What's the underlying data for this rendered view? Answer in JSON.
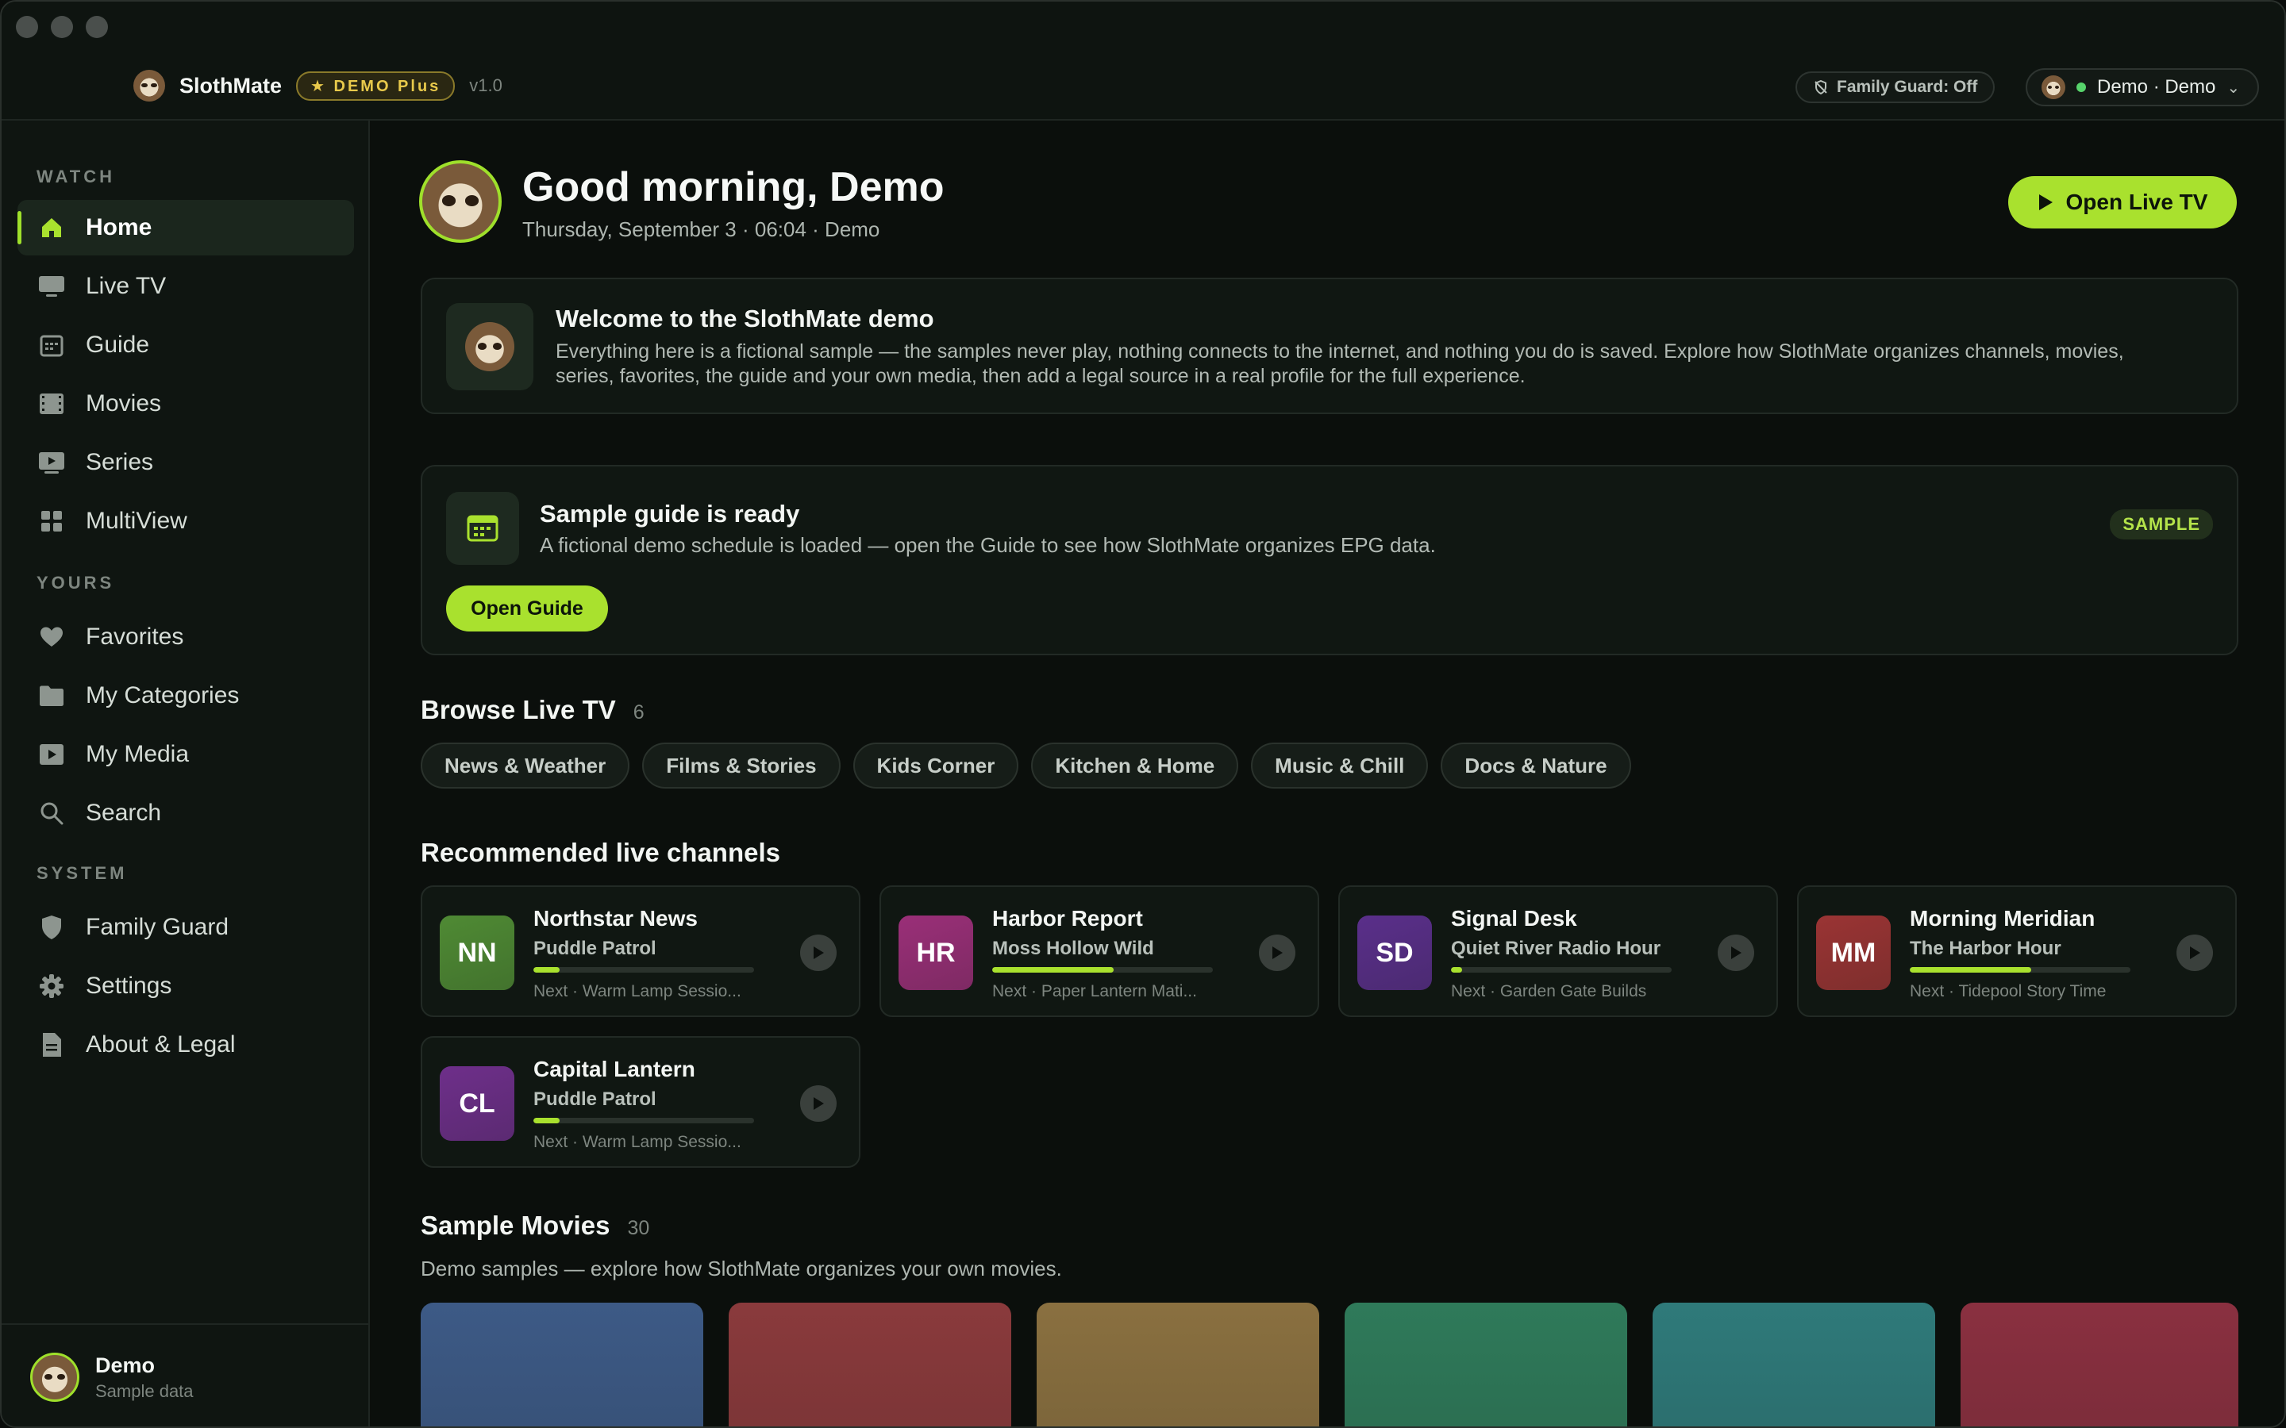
{
  "app": {
    "name": "SlothMate",
    "badge": "★ DEMO Plus",
    "version": "v1.0",
    "family_guard_pill": "Family Guard: Off",
    "user_pill": "Demo · Demo"
  },
  "sidebar": {
    "sections": {
      "watch": "WATCH",
      "yours": "YOURS",
      "system": "SYSTEM"
    },
    "items": [
      {
        "label": "Home",
        "icon": "home-icon",
        "active": true
      },
      {
        "label": "Live TV",
        "icon": "tv-icon"
      },
      {
        "label": "Guide",
        "icon": "calendar-icon"
      },
      {
        "label": "Movies",
        "icon": "film-icon"
      },
      {
        "label": "Series",
        "icon": "play-screen-icon"
      },
      {
        "label": "MultiView",
        "icon": "grid-icon"
      },
      {
        "label": "Favorites",
        "icon": "heart-icon"
      },
      {
        "label": "My Categories",
        "icon": "folder-icon"
      },
      {
        "label": "My Media",
        "icon": "media-icon"
      },
      {
        "label": "Search",
        "icon": "search-icon"
      },
      {
        "label": "Family Guard",
        "icon": "shield-icon"
      },
      {
        "label": "Settings",
        "icon": "gear-icon"
      },
      {
        "label": "About & Legal",
        "icon": "document-icon"
      }
    ],
    "footer": {
      "name": "Demo",
      "sub": "Sample data"
    }
  },
  "header": {
    "greeting": "Good morning, Demo",
    "subtitle": "Thursday, September 3 · 06:04 · Demo",
    "live_button": "Open Live TV"
  },
  "welcome": {
    "title": "Welcome to the SlothMate demo",
    "description": "Everything here is a fictional sample — the samples never play, nothing connects to the internet, and nothing you do is saved. Explore how SlothMate organizes channels, movies, series, favorites, the guide and your own media, then add a legal source in a real profile for the full experience."
  },
  "guide_card": {
    "title": "Sample guide is ready",
    "description": "A fictional demo schedule is loaded — open the Guide to see how SlothMate organizes EPG data.",
    "button": "Open Guide",
    "badge": "SAMPLE"
  },
  "browse": {
    "title": "Browse Live TV",
    "count": "6",
    "chips": [
      "News & Weather",
      "Films & Stories",
      "Kids Corner",
      "Kitchen & Home",
      "Music & Chill",
      "Docs & Nature"
    ]
  },
  "recommended": {
    "title": "Recommended live channels",
    "channels": [
      {
        "initials": "NN",
        "name": "Northstar News",
        "show": "Puddle Patrol",
        "progress": 0.12,
        "next": "Next · Warm Lamp Sessio...",
        "color": "#4f8a34"
      },
      {
        "initials": "HR",
        "name": "Harbor Report",
        "show": "Moss Hollow Wild",
        "progress": 0.55,
        "next": "Next · Paper Lantern Mati...",
        "color": "#9a2f78"
      },
      {
        "initials": "SD",
        "name": "Signal Desk",
        "show": "Quiet River Radio Hour",
        "progress": 0.05,
        "next": "Next · Garden Gate Builds",
        "color": "#5a2f8a"
      },
      {
        "initials": "MM",
        "name": "Morning Meridian",
        "show": "The Harbor Hour",
        "progress": 0.55,
        "next": "Next · Tidepool Story Time",
        "color": "#9a3434"
      },
      {
        "initials": "CL",
        "name": "Capital Lantern",
        "show": "Puddle Patrol",
        "progress": 0.12,
        "next": "Next · Warm Lamp Sessio...",
        "color": "#6e2f8a"
      }
    ]
  },
  "movies": {
    "title": "Sample Movies",
    "count": "30",
    "subtitle": "Demo samples — explore how SlothMate organizes your own movies.",
    "poster_colors": [
      "#3d5a86",
      "#8a3a3c",
      "#8a7040",
      "#2f7a5a",
      "#2f7a7a",
      "#8a3040"
    ]
  },
  "colors": {
    "accent": "#a9e12e",
    "background": "#0b0f0c",
    "card": "#101712"
  }
}
